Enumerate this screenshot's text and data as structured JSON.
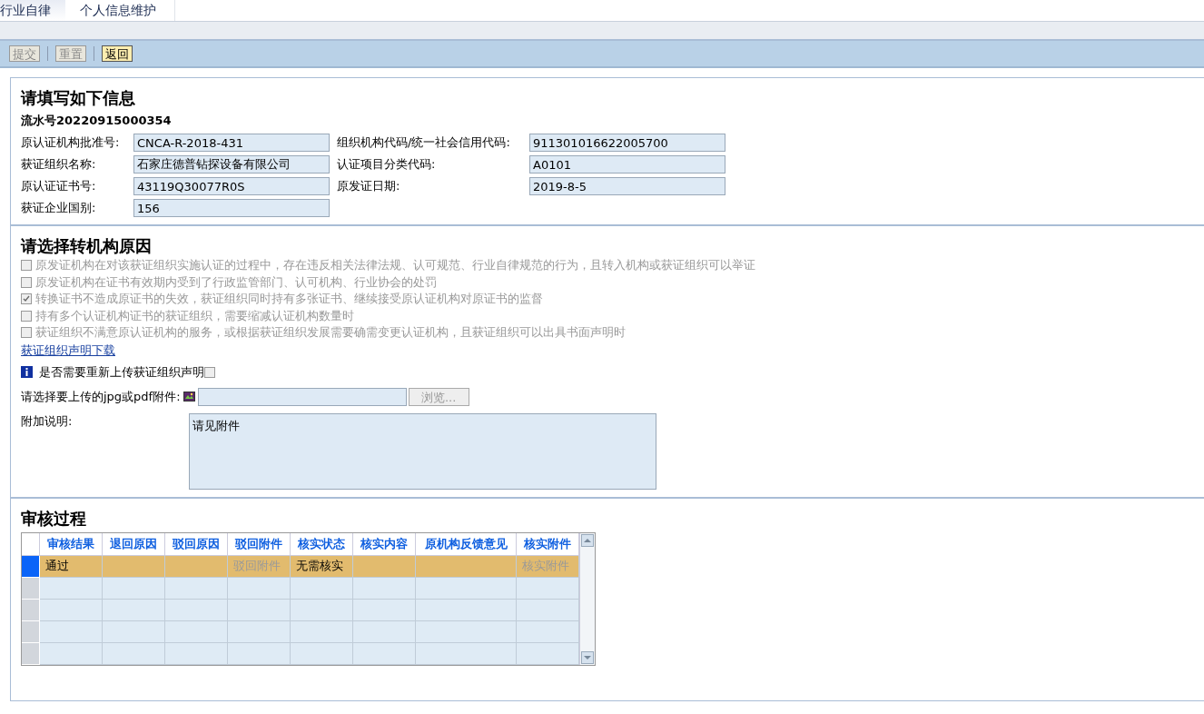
{
  "tabs": [
    {
      "label": "行业自律",
      "selected": false
    },
    {
      "label": "个人信息维护",
      "selected": true
    }
  ],
  "toolbar": [
    {
      "label": "提交",
      "disabled": true
    },
    {
      "label": "重置",
      "disabled": true
    },
    {
      "label": "返回",
      "disabled": false
    }
  ],
  "info": {
    "title": "请填写如下信息",
    "serial": "流水号20220915000354",
    "fields": [
      {
        "label": "原认证机构批准号:",
        "value": "CNCA-R-2018-431"
      },
      {
        "label": "组织机构代码/统一社会信用代码:",
        "value": "911301016622005700"
      },
      {
        "label": "获证组织名称:",
        "value": "石家庄德普钻探设备有限公司"
      },
      {
        "label": "认证项目分类代码:",
        "value": "A0101"
      },
      {
        "label": "原认证证书号:",
        "value": "43119Q30077R0S"
      },
      {
        "label": "原发证日期:",
        "value": "2019-8-5"
      },
      {
        "label": "获证企业国别:",
        "value": "156"
      }
    ]
  },
  "reasons": {
    "title": "请选择转机构原因",
    "disabled": true,
    "items": [
      {
        "label": "原发证机构在对该获证组织实施认证的过程中，存在违反相关法律法规、认可规范、行业自律规范的行为，且转入机构或获证组织可以举证",
        "checked": false
      },
      {
        "label": "原发证机构在证书有效期内受到了行政监管部门、认可机构、行业协会的处罚",
        "checked": false
      },
      {
        "label": "转换证书不造成原证书的失效，获证组织同时持有多张证书、继续接受原认证机构对原证书的监督",
        "checked": true
      },
      {
        "label": "持有多个认证机构证书的获证组织，需要缩减认证机构数量时",
        "checked": false
      },
      {
        "label": "获证组织不满意原认证机构的服务，或根据获证组织发展需要确需变更认证机构，且获证组织可以出具书面声明时",
        "checked": false
      }
    ],
    "download_link": "获证组织声明下载",
    "reupload": {
      "label": "是否需要重新上传获证组织声明",
      "checked": false
    },
    "upload": {
      "label": "请选择要上传的jpg或pdf附件:",
      "button": "浏览..."
    },
    "note": {
      "label": "附加说明:",
      "value": "请见附件"
    }
  },
  "review": {
    "title": "审核过程",
    "columns": [
      "审核结果",
      "退回原因",
      "驳回原因",
      "驳回附件",
      "核实状态",
      "核实内容",
      "原机构反馈意见",
      "核实附件"
    ],
    "rows": [
      {
        "selected": true,
        "cells": [
          {
            "text": "通过",
            "kind": "text"
          },
          null,
          null,
          {
            "text": "驳回附件",
            "kind": "link"
          },
          {
            "text": "无需核实",
            "kind": "text"
          },
          null,
          null,
          {
            "text": "核实附件",
            "kind": "link"
          }
        ]
      },
      {
        "selected": false
      },
      {
        "selected": false
      },
      {
        "selected": false
      },
      {
        "selected": false
      }
    ]
  }
}
